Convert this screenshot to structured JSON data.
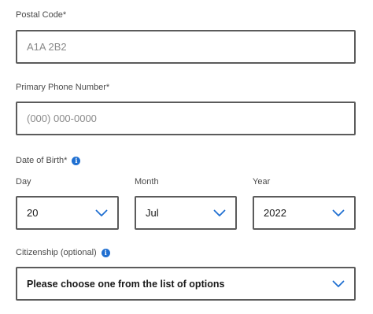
{
  "postal_code": {
    "label": "Postal Code*",
    "placeholder": "A1A 2B2"
  },
  "phone": {
    "label": "Primary Phone Number*",
    "placeholder": "(000) 000-0000"
  },
  "dob": {
    "label": "Date of Birth*",
    "info_icon": "i",
    "day": {
      "label": "Day",
      "value": "20"
    },
    "month": {
      "label": "Month",
      "value": "Jul"
    },
    "year": {
      "label": "Year",
      "value": "2022"
    }
  },
  "citizenship": {
    "label": "Citizenship (optional)",
    "info_icon": "i",
    "value": "Please choose one from the list of options"
  },
  "colors": {
    "chevron": "#1f6fd1",
    "info": "#1f6fd1",
    "border": "#5b5b5b"
  }
}
